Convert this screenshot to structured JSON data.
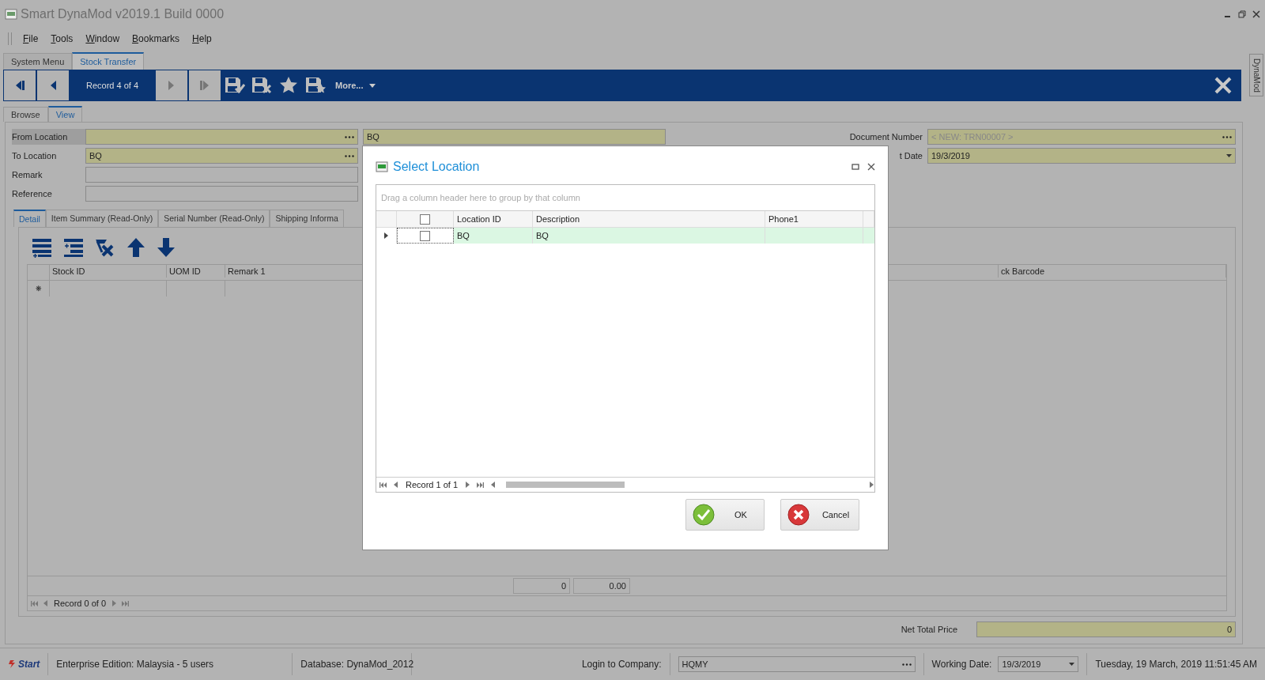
{
  "window": {
    "title": "Smart DynaMod v2019.1 Build 0000"
  },
  "menu": [
    "File",
    "Tools",
    "Window",
    "Bookmarks",
    "Help"
  ],
  "doc_tabs": [
    {
      "label": "System Menu",
      "selected": false
    },
    {
      "label": "Stock Transfer",
      "selected": true
    }
  ],
  "toolbar": {
    "record": "Record 4 of 4",
    "more": "More..."
  },
  "side_tab": "DynaMod",
  "view_tabs": [
    {
      "label": "Browse",
      "selected": false
    },
    {
      "label": "View",
      "selected": true
    }
  ],
  "fields": [
    {
      "label": "From Location",
      "kind": "lookup",
      "focused": true
    },
    {
      "label": "To Location",
      "value": "BQ",
      "kind": "lookup",
      "focused": false
    },
    {
      "label": "Remark",
      "kind": "text",
      "focused": false
    },
    {
      "label": "Reference",
      "kind": "text",
      "focused": false
    }
  ],
  "from_description": "BQ",
  "document_number": {
    "label": "Document Number",
    "placeholder": "< NEW: TRN00007 >"
  },
  "document_date": {
    "label": "t Date",
    "value": "19/3/2019"
  },
  "detail_tabs": [
    {
      "label": "Detail",
      "selected": true
    },
    {
      "label": "Item Summary (Read-Only)",
      "selected": false
    },
    {
      "label": "Serial Number (Read-Only)",
      "selected": false
    },
    {
      "label": "Shipping Informa",
      "selected": false
    }
  ],
  "detail_grid": {
    "columns": [
      "Stock ID",
      "UOM ID",
      "Remark 1",
      "ck Barcode"
    ],
    "new_row_marker": "❋",
    "totals": [
      "0",
      "0.00"
    ],
    "nav": "Record 0 of 0"
  },
  "net_total": {
    "label": "Net Total Price",
    "value": "0"
  },
  "status_bar": {
    "start": "Start",
    "edition": "Enterprise Edition: Malaysia - 5 users",
    "database": "Database: DynaMod_2012",
    "company_label": "Login to Company:",
    "company": "HQMY",
    "working_date_label": "Working Date:",
    "working_date": "19/3/2019",
    "datetime": "Tuesday, 19 March, 2019 11:51:45 AM"
  },
  "dialog": {
    "title": "Select Location",
    "group_hint": "Drag a column header here to group by that column",
    "columns": [
      "Location ID",
      "Description",
      "Phone1"
    ],
    "header_checked": false,
    "rows": [
      {
        "checked": false,
        "selected": true,
        "location_id": "BQ",
        "description": "BQ"
      }
    ],
    "nav": "Record 1 of 1",
    "buttons": [
      {
        "kind": "ok",
        "label": "OK"
      },
      {
        "kind": "cancel",
        "label": "Cancel"
      }
    ]
  }
}
